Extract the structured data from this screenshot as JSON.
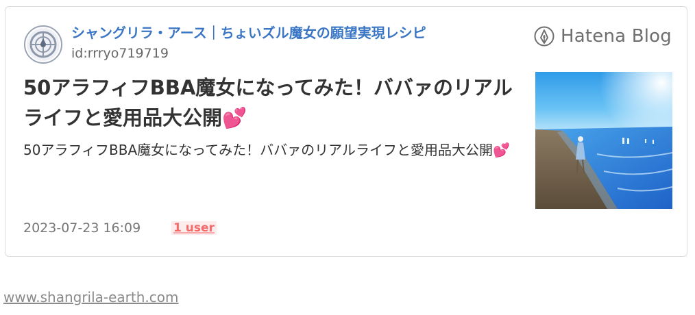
{
  "card": {
    "site_title": "シャングリラ・アース｜ちょいズル魔女の願望実現レシピ",
    "blog_id": "id:rrryo719719",
    "brand_label": "Hatena Blog",
    "entry_title_text": "50アラフィフBBA魔女になってみた！ババァのリアルライフと愛用品大公開",
    "entry_title_emoji": "💕",
    "description_text": "50アラフィフBBA魔女になってみた！ババァのリアルライフと愛用品大公開",
    "description_emoji": "💕",
    "date": "2023-07-23 16:09",
    "bookmark_users": "1 user"
  },
  "footer": {
    "url": "www.shangrila-earth.com"
  },
  "colors": {
    "link_blue": "#3a76c4",
    "bookmark_red": "#f36b6b",
    "border": "#dcdcdc"
  },
  "icons": {
    "avatar": "blog-emblem-avatar",
    "brand": "hatena-pen-icon",
    "thumbnail": "beach-photo-thumbnail"
  }
}
